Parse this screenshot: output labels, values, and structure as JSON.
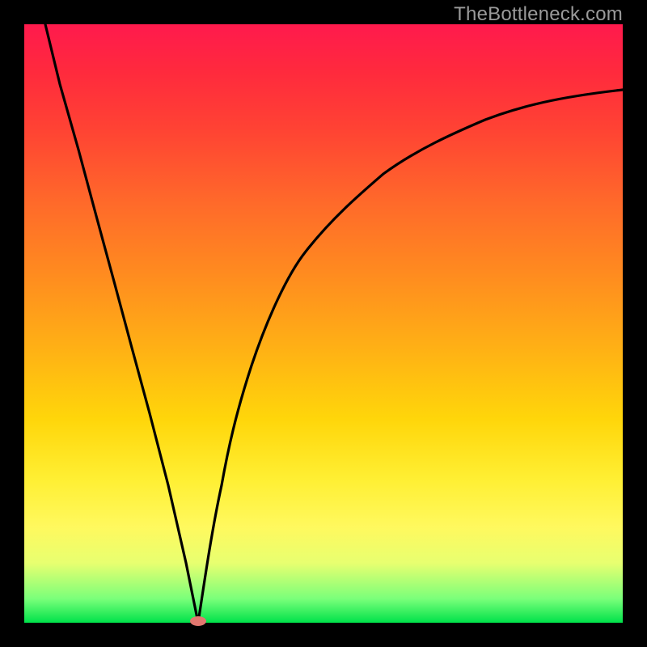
{
  "watermark": "TheBottleneck.com",
  "colors": {
    "background": "#000000",
    "curve_stroke": "#000000",
    "minimum_marker": "#e2776f",
    "gradient_top": "#ff1a4d",
    "gradient_bottom": "#00e24a"
  },
  "chart_data": {
    "type": "line",
    "title": "",
    "xlabel": "",
    "ylabel": "",
    "xlim": [
      0,
      100
    ],
    "ylim": [
      0,
      100
    ],
    "grid": false,
    "legend": false,
    "annotations": [
      {
        "type": "minimum_marker",
        "x": 29,
        "y": 0
      }
    ],
    "series": [
      {
        "name": "left_branch",
        "x": [
          3.5,
          6,
          9,
          12,
          15,
          18,
          21,
          24,
          27,
          29
        ],
        "values": [
          100,
          90,
          79,
          68,
          57,
          46,
          35,
          23,
          10,
          0
        ]
      },
      {
        "name": "right_branch",
        "x": [
          29,
          31,
          33,
          35,
          38,
          42,
          47,
          53,
          60,
          68,
          77,
          87,
          100
        ],
        "values": [
          0,
          12,
          23,
          32,
          43,
          53,
          62,
          69,
          75,
          80,
          84,
          87,
          89
        ]
      }
    ]
  }
}
